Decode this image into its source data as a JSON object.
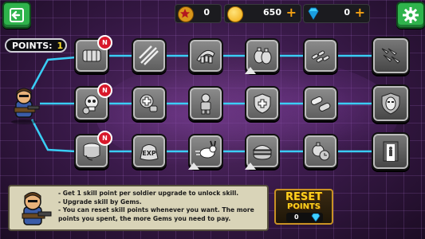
{
  "header": {
    "stars": "0",
    "coins": "650",
    "gems": "0"
  },
  "points": {
    "label": "POINTS:",
    "value": "1"
  },
  "tree": {
    "rows": [
      {
        "nodes": [
          {
            "name": "bullet-belt-icon",
            "new": true
          },
          {
            "name": "rifle-rack-icon",
            "new": false
          },
          {
            "name": "ammo-belt-icon",
            "new": false
          },
          {
            "name": "grenade-upgrade-icon",
            "new": false
          },
          {
            "name": "bullets-pile-icon",
            "new": false
          }
        ],
        "final": "missiles-icon"
      },
      {
        "nodes": [
          {
            "name": "skull-bomb-icon",
            "new": true
          },
          {
            "name": "medkit-icon",
            "new": false
          },
          {
            "name": "soldier-icon",
            "new": false
          },
          {
            "name": "armor-shield-icon",
            "new": false
          },
          {
            "name": "pills-icon",
            "new": false
          }
        ],
        "final": "masked-face-shield-icon"
      },
      {
        "nodes": [
          {
            "name": "coin-stack-icon",
            "new": true
          },
          {
            "name": "exp-bag-icon",
            "new": false
          },
          {
            "name": "rabbit-speed-icon",
            "new": false
          },
          {
            "name": "burger-icon",
            "new": false
          },
          {
            "name": "grenade-clock-icon",
            "new": false
          }
        ],
        "final": "door-light-icon"
      }
    ],
    "badge_text": "N"
  },
  "info": {
    "lines": [
      "- Get 1 skill point per soldier upgrade to unlock skill.",
      "- Upgrade skill by Gems.",
      "- You can reset skill points whenever you want. The more points you spent, the more Gems you need to pay."
    ]
  },
  "reset": {
    "line1": "RESET",
    "line2": "POINTS",
    "cost": "0"
  },
  "colors": {
    "accent_green": "#2fb34c",
    "line_cyan": "#3ad7ff",
    "badge_red": "#d8182a",
    "gold": "#ffd21e"
  }
}
